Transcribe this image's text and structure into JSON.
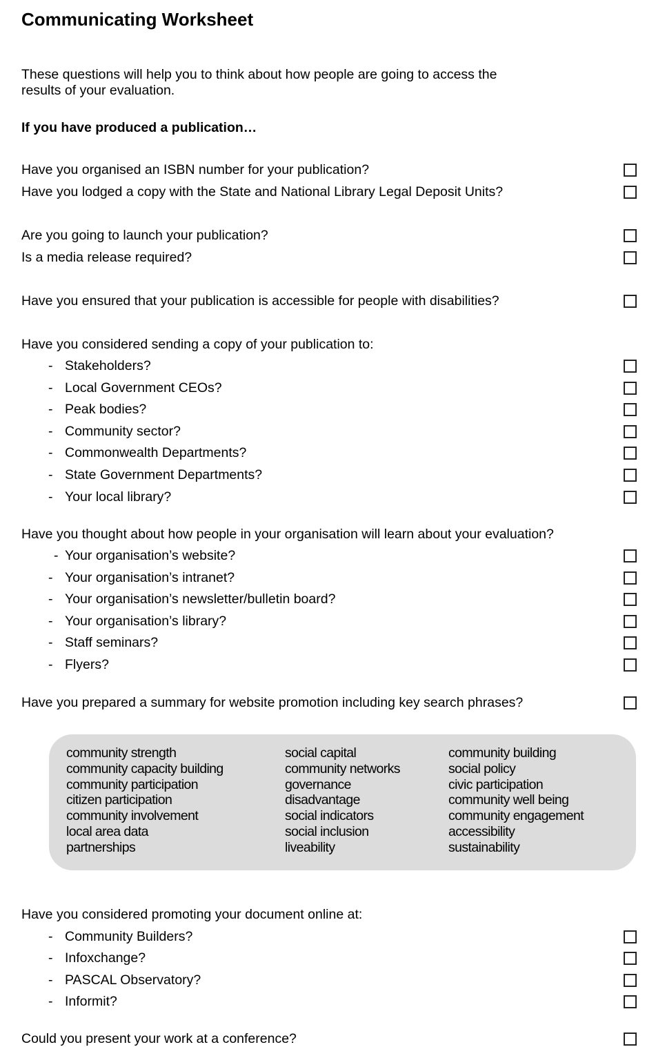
{
  "title": "Communicating Worksheet",
  "intro": "These questions will help you to think about how people are going to access the results of your evaluation.",
  "subheading": "If you have produced a publication…",
  "questions": {
    "isbn": "Have you organised an ISBN number for your publication?",
    "legal_deposit": "Have you lodged a copy with the State and National Library Legal Deposit Units?",
    "launch": "Are you going to launch your publication?",
    "media_release": "Is a media release required?",
    "accessible": "Have you ensured that your publication is accessible for people with disabilities?",
    "send_copy": "Have you considered sending a copy of your publication to:",
    "org_learn": "Have you thought about how people in your organisation will learn about your evaluation?",
    "summary": "Have you prepared a summary for website promotion including key search phrases?",
    "promote_online": "Have you considered promoting your document online at:",
    "conference": "Could you present your work at a conference?"
  },
  "send_copy_items": [
    "Stakeholders?",
    "Local Government CEOs?",
    "Peak bodies?",
    "Community sector?",
    "Commonwealth Departments?",
    "State Government Departments?",
    "Your local library?"
  ],
  "org_items": [
    "Your organisation’s website?",
    "Your organisation’s intranet?",
    "Your organisation’s newsletter/bulletin board?",
    "Your organisation’s library?",
    "Staff seminars?",
    "Flyers?"
  ],
  "online_items": [
    "Community Builders?",
    "Infoxchange?",
    "PASCAL Observatory?",
    "Informit?"
  ],
  "dash": "-",
  "keywords": {
    "col1": [
      "community strength",
      "community capacity building",
      "community participation",
      "citizen participation",
      "community involvement",
      "local area data",
      "partnerships"
    ],
    "col2": [
      "social capital",
      "community networks",
      "governance",
      "disadvantage",
      "social indicators",
      "social inclusion",
      "liveability"
    ],
    "col3": [
      "community building",
      "social policy",
      "civic participation",
      "community well being",
      "community engagement",
      "accessibility",
      "sustainability"
    ]
  }
}
